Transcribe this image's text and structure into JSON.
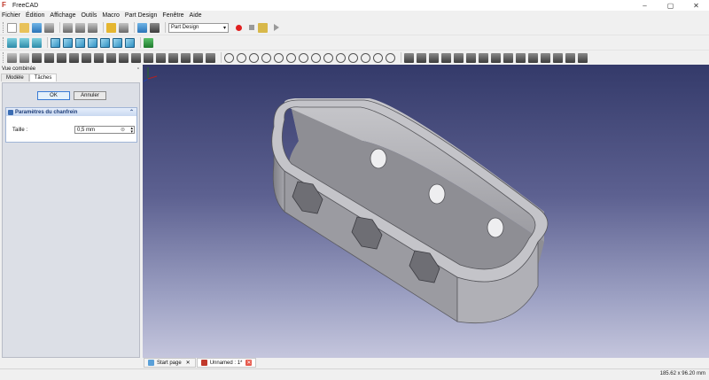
{
  "window": {
    "title": "FreeCAD",
    "controls": [
      "–",
      "▢",
      "✕"
    ]
  },
  "menu": [
    "Fichier",
    "Édition",
    "Affichage",
    "Outils",
    "Macro",
    "Part Design",
    "Fenêtre",
    "Aide"
  ],
  "workbench": {
    "selected": "Part Design"
  },
  "combo_view": {
    "title": "Vue combinée",
    "tabs": [
      "Modèle",
      "Tâches"
    ],
    "active_tab": "Tâches"
  },
  "task": {
    "ok_label": "OK",
    "cancel_label": "Annuler",
    "group_title": "Paramètres du chanfrein",
    "size_label": "Taille :",
    "size_value": "0,5 mm"
  },
  "document_tabs": [
    {
      "label": "Start page",
      "active": false
    },
    {
      "label": "Unnamed : 1*",
      "active": true
    }
  ],
  "status": {
    "dimensions": "185.62 x 96.20 mm"
  },
  "colors": {
    "accent": "#3a7bd5",
    "viewport_top": "#343a6a",
    "viewport_bottom": "#c5c6dd",
    "model": "#9c9ca2"
  }
}
